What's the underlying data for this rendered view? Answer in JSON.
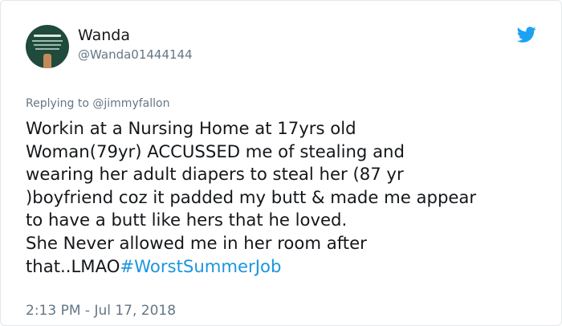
{
  "author": {
    "name": "Wanda",
    "handle": "@Wanda01444144"
  },
  "reply": {
    "prefix": "Replying to",
    "mention": "@jimmyfallon"
  },
  "tweet": {
    "lines": [
      "Workin at a Nursing Home at 17yrs old",
      "Woman(79yr) ACCUSSED me of stealing and",
      "wearing her adult diapers to steal her (87 yr",
      ")boyfriend coz it padded my butt & made me appear",
      "to have a butt like hers that he loved.",
      "She Never allowed me in her room after"
    ],
    "last_line_text": "that..LMAO",
    "hashtag": "#WorstSummerJob"
  },
  "meta": {
    "timestamp": "2:13 PM - Jul 17, 2018"
  },
  "icons": {
    "brand": "twitter-bird-icon"
  },
  "colors": {
    "brand": "#1da1f2",
    "hashtag": "#1b95e0",
    "secondary_text": "#657786"
  }
}
